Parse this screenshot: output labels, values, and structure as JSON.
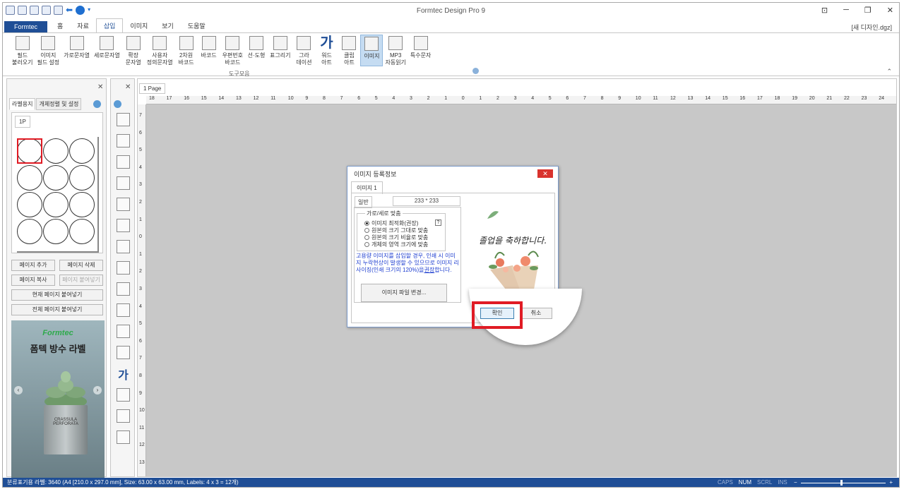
{
  "app": {
    "title": "Formtec Design Pro 9",
    "document": "[새 디자인.dgz]"
  },
  "ribbon": {
    "tabs": [
      "Formtec",
      "홈",
      "자료",
      "삽입",
      "이미지",
      "보기",
      "도움말"
    ],
    "active_tab": "삽입",
    "buttons": [
      {
        "label": "필드\n불러오기",
        "icon": "field-load-icon"
      },
      {
        "label": "이미지\n필드 설정",
        "icon": "image-field-icon"
      },
      {
        "label": "가로문자열",
        "icon": "horizontal-text-icon"
      },
      {
        "label": "세로문자열",
        "icon": "vertical-text-icon"
      },
      {
        "label": "확장\n문자열",
        "icon": "extended-text-icon"
      },
      {
        "label": "사용자\n정의문자열",
        "icon": "custom-text-icon"
      },
      {
        "label": "2차원\n바코드",
        "icon": "qr-code-icon"
      },
      {
        "label": "바코드",
        "icon": "barcode-icon"
      },
      {
        "label": "우편번호\n바코드",
        "icon": "postal-barcode-icon"
      },
      {
        "label": "선·도형",
        "icon": "shape-icon"
      },
      {
        "label": "표그리기",
        "icon": "table-icon"
      },
      {
        "label": "그라\n데이션",
        "icon": "gradient-icon"
      },
      {
        "label": "워드\n아트",
        "icon": "wordart-icon"
      },
      {
        "label": "클립\n아트",
        "icon": "clipart-icon"
      },
      {
        "label": "이미지",
        "icon": "image-icon"
      },
      {
        "label": "MP3\n자동읽기",
        "icon": "mp3-icon"
      },
      {
        "label": "특수문자",
        "icon": "special-char-icon"
      }
    ],
    "group_label": "도구모음"
  },
  "left_panel": {
    "tabs": [
      "라벨용지",
      "개체정렬 및 설정"
    ],
    "page_tab": "1P",
    "buttons": {
      "add_page": "페이지 추가",
      "delete_page": "페이지 삭제",
      "copy_page": "페이지 복사",
      "paste_page": "페이지 붙여넣기",
      "paste_current": "현재 페이지 붙여넣기",
      "paste_all": "전체 페이지 붙여넣기"
    },
    "ad": {
      "brand": "Formtec",
      "title": "폼텍 방수 라벨",
      "pot_text": "CRASSULA\nPERFORATA"
    }
  },
  "canvas": {
    "page_tab": "1 Page",
    "hruler": [
      "18",
      "17",
      "16",
      "15",
      "14",
      "13",
      "12",
      "11",
      "10",
      "9",
      "8",
      "7",
      "6",
      "5",
      "4",
      "3",
      "2",
      "1",
      "0",
      "1",
      "2",
      "3",
      "4",
      "5",
      "6",
      "7",
      "8",
      "9",
      "10",
      "11",
      "12",
      "13",
      "14",
      "15",
      "16",
      "17",
      "18",
      "19",
      "20",
      "21",
      "22",
      "23",
      "24"
    ],
    "vruler": [
      "7",
      "6",
      "5",
      "4",
      "3",
      "2",
      "1",
      "0",
      "1",
      "2",
      "3",
      "4",
      "5",
      "6",
      "7",
      "8",
      "9",
      "10",
      "11",
      "12",
      "13"
    ]
  },
  "dialog": {
    "title": "이미지 등록정보",
    "tab": "이미지 1",
    "general_tab": "일반",
    "size": "233 * 233",
    "fit_legend": "가로/세로 맞춤",
    "options": [
      "이미지 최적화(권장)",
      "원본의 크기 그대로 맞춤",
      "원본의 크기 비율로 맞춤",
      "개체의 영역 크기에 맞춤"
    ],
    "selected_option": 0,
    "help": "?",
    "note": "고용량 이미지를 삽입할 경우, 인쇄 시 이미지 누락현상이 발생할 수 있으므로 이미지 리사이징(인쇄 크기의 120%)을",
    "note_link": "권장",
    "note_tail": "합니다.",
    "change_file": "이미지 파일 변경...",
    "preview_text": "졸업을 축하합니다.",
    "ok": "확인",
    "cancel": "취소"
  },
  "status": {
    "text": "분류표기용 라벨: 3640 (A4 [210.0 x 297.0 mm], Size: 63.00 x 63.00 mm,  Labels: 4 x 3 = 12개)",
    "keys": [
      "CAPS",
      "NUM",
      "SCRL",
      "INS"
    ],
    "active_keys": [
      "NUM"
    ],
    "zoom_minus": "−",
    "zoom_plus": "+"
  }
}
